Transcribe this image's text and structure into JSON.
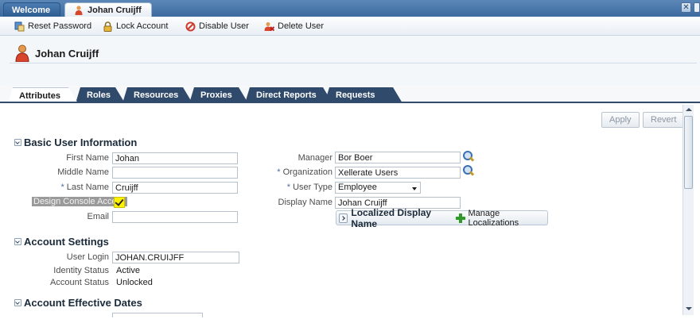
{
  "window_tabs": [
    {
      "label": "Welcome"
    },
    {
      "label": "Johan Cruijff"
    }
  ],
  "toolbar": {
    "reset_password": "Reset Password",
    "lock_account": "Lock Account",
    "disable_user": "Disable User",
    "delete_user": "Delete User"
  },
  "header": {
    "title": "Johan Cruijff"
  },
  "tabs": [
    {
      "label": "Attributes"
    },
    {
      "label": "Roles"
    },
    {
      "label": "Resources"
    },
    {
      "label": "Proxies"
    },
    {
      "label": "Direct Reports"
    },
    {
      "label": "Requests"
    }
  ],
  "actions": {
    "apply": "Apply",
    "revert": "Revert"
  },
  "basic": {
    "title": "Basic User Information",
    "first_name_label": "First Name",
    "first_name": "Johan",
    "middle_name_label": "Middle Name",
    "middle_name": "",
    "last_name_label": "Last Name",
    "last_name": "Cruijff",
    "design_console_label": "Design Console Access",
    "design_console_checked": true,
    "email_label": "Email",
    "email": "",
    "manager_label": "Manager",
    "manager": "Bor Boer",
    "organization_label": "Organization",
    "organization": "Xellerate Users",
    "user_type_label": "User Type",
    "user_type": "Employee",
    "display_name_label": "Display Name",
    "display_name": "Johan Cruijff",
    "required_mark": "*",
    "localized_title": "Localized Display Name",
    "manage_localizations": "Manage Localizations"
  },
  "account": {
    "title": "Account Settings",
    "user_login_label": "User Login",
    "user_login": "JOHAN.CRUIJFF",
    "identity_status_label": "Identity Status",
    "identity_status": "Active",
    "account_status_label": "Account Status",
    "account_status": "Unlocked"
  },
  "dates": {
    "title": "Account Effective Dates"
  },
  "colors": {
    "topbar": "#3c6a9e",
    "tab_dark": "#2f4a6b",
    "checkbox_highlight": "#fff200"
  }
}
